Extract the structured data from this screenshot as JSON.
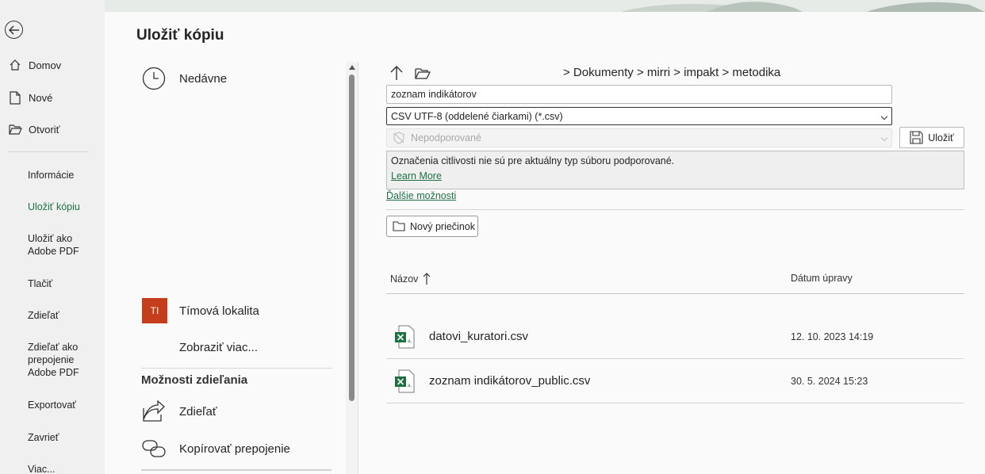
{
  "nav": {
    "home": "Domov",
    "new": "Nové",
    "open": "Otvoriť",
    "items": [
      "Informácie",
      "Uložiť kópiu",
      "Uložiť ako Adobe PDF",
      "Tlačiť",
      "Zdieľať",
      "Zdieľať ako prepojenie Adobe PDF",
      "Exportovať",
      "Zavrieť",
      "Viac..."
    ]
  },
  "title": "Uložiť kópiu",
  "locations": {
    "recent": "Nedávne",
    "team_badge": "TI",
    "team": "Tímová lokalita",
    "show_more": "Zobraziť viac...",
    "sharing_heading": "Možnosti zdieľania",
    "share": "Zdieľať",
    "copy_link": "Kopírovať prepojenie"
  },
  "save": {
    "path": "> Dokumenty > mirri > impakt > metodika",
    "filename": "zoznam indikátorov",
    "filetype": "CSV UTF-8 (oddelené čiarkami) (*.csv)",
    "sensitivity": "Nepodporované",
    "save_label": "Uložiť",
    "info_message": "Označenia citlivosti nie sú pre aktuálny typ súboru podporované.",
    "learn_more": "Learn More",
    "more_options": "Ďalšie možnosti",
    "new_folder": "Nový priečinok",
    "col_name": "Názov",
    "col_date": "Dátum úpravy"
  },
  "files": [
    {
      "name": "datovi_kuratori.csv",
      "date": "12. 10. 2023 14:19"
    },
    {
      "name": "zoznam indikátorov_public.csv",
      "date": "30. 5. 2024 15:23"
    }
  ],
  "colors": {
    "accent": "#1e7145",
    "team_badge": "#c43e1c"
  }
}
